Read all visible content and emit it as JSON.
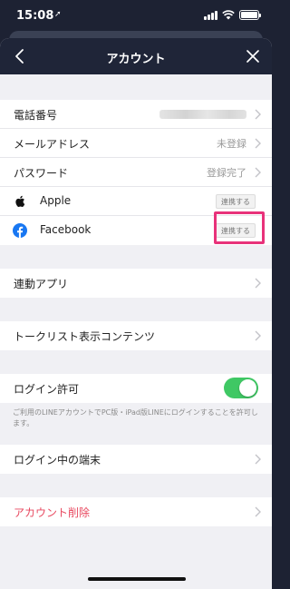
{
  "status_bar": {
    "time": "15:08",
    "location_glyph": "➚"
  },
  "header": {
    "title": "アカウント"
  },
  "account": {
    "phone_label": "電話番号",
    "email_label": "メールアドレス",
    "email_value": "未登録",
    "password_label": "パスワード",
    "password_value": "登録完了",
    "apple_label": "Apple",
    "apple_button": "連携する",
    "facebook_label": "Facebook",
    "facebook_button": "連携する"
  },
  "linked_apps": {
    "label": "連動アプリ"
  },
  "talk_list": {
    "label": "トークリスト表示コンテンツ"
  },
  "login": {
    "allow_label": "ログイン許可",
    "allow_enabled": true,
    "note": "ご利用のLINEアカウントでPC版・iPad版LINEにログインすることを許可します。",
    "devices_label": "ログイン中の端末"
  },
  "delete": {
    "label": "アカウント削除"
  },
  "colors": {
    "header_bg": "#1f2538",
    "toggle_on": "#3fc864",
    "danger": "#e8485f",
    "highlight": "#e8327a"
  }
}
